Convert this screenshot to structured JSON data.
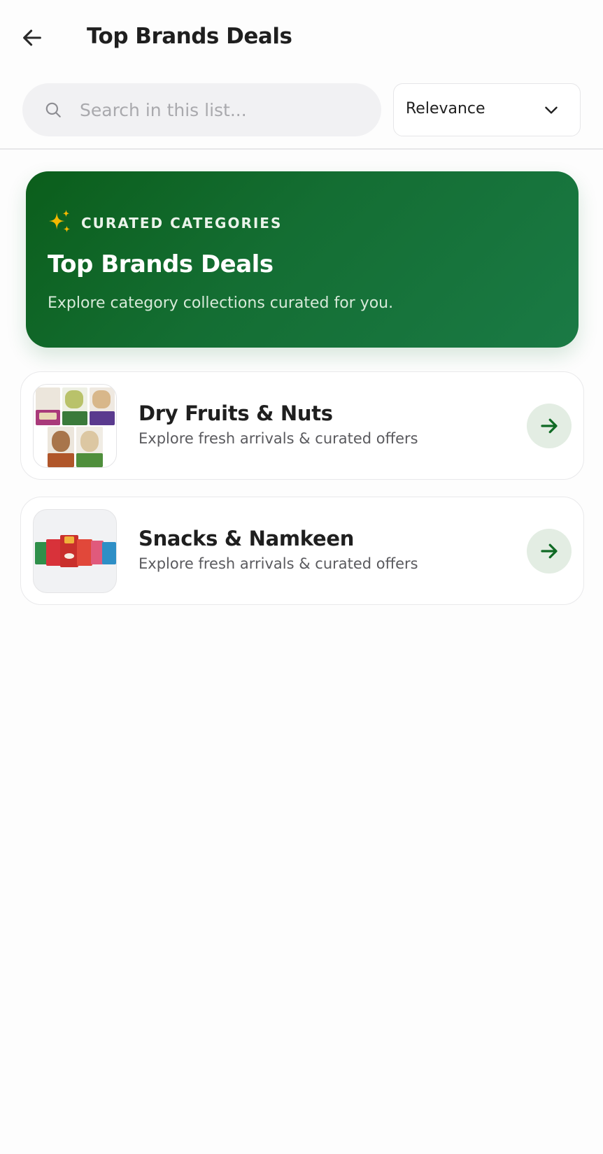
{
  "header": {
    "title": "Top Brands Deals",
    "back_icon": "arrow-left-icon"
  },
  "search": {
    "placeholder": "Search in this list...",
    "value": "",
    "icon": "search-icon"
  },
  "sort": {
    "selected": "Relevance",
    "icon": "chevron-down-icon"
  },
  "banner": {
    "eyebrow": "CURATED CATEGORIES",
    "title": "Top Brands Deals",
    "subtitle": "Explore category collections curated for you.",
    "icon": "sparkle-icon",
    "accent_color": "#146e33",
    "sparkle_color": "#f5b800"
  },
  "categories": [
    {
      "title": "Dry Fruits & Nuts",
      "subtitle": "Explore fresh arrivals & curated offers",
      "icon": "arrow-right-icon"
    },
    {
      "title": "Snacks & Namkeen",
      "subtitle": "Explore fresh arrivals & curated offers",
      "icon": "arrow-right-icon"
    }
  ],
  "colors": {
    "arrow_bg": "#e3ede3",
    "arrow_fg": "#0f6a24"
  }
}
